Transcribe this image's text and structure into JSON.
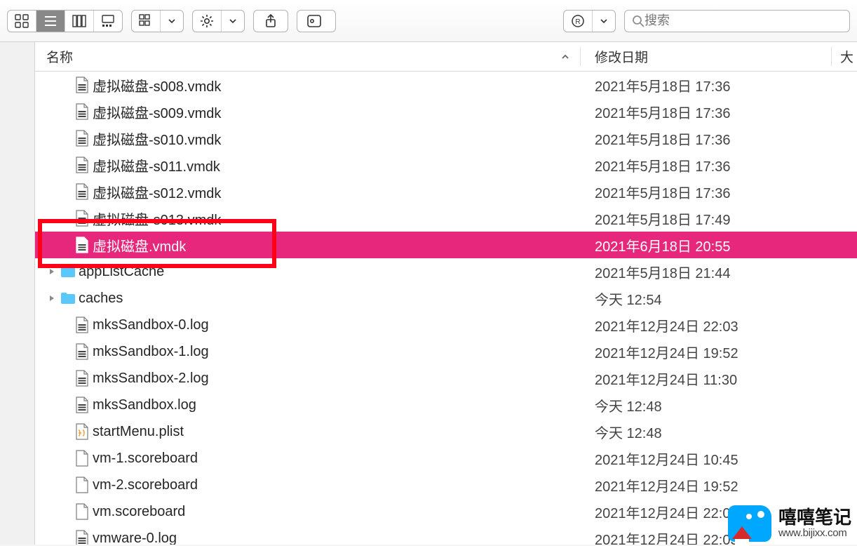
{
  "toolbar": {
    "search_placeholder": "搜索"
  },
  "columns": {
    "name": "名称",
    "date": "修改日期",
    "size": "大"
  },
  "files": [
    {
      "name": "虚拟磁盘-s008.vmdk",
      "date": "2021年5月18日 17:36",
      "type": "vmdk",
      "indent": 1
    },
    {
      "name": "虚拟磁盘-s009.vmdk",
      "date": "2021年5月18日 17:36",
      "type": "vmdk",
      "indent": 1
    },
    {
      "name": "虚拟磁盘-s010.vmdk",
      "date": "2021年5月18日 17:36",
      "type": "vmdk",
      "indent": 1
    },
    {
      "name": "虚拟磁盘-s011.vmdk",
      "date": "2021年5月18日 17:36",
      "type": "vmdk",
      "indent": 1
    },
    {
      "name": "虚拟磁盘-s012.vmdk",
      "date": "2021年5月18日 17:36",
      "type": "vmdk",
      "indent": 1
    },
    {
      "name": "虚拟磁盘-s013.vmdk",
      "date": "2021年5月18日 17:49",
      "type": "vmdk",
      "indent": 1
    },
    {
      "name": "虚拟磁盘.vmdk",
      "date": "2021年6月18日 20:55",
      "type": "vmdk",
      "indent": 1,
      "selected": true
    },
    {
      "name": "appListCache",
      "date": "2021年5月18日 21:44",
      "type": "folder",
      "indent": 0,
      "expandable": true
    },
    {
      "name": "caches",
      "date": "今天 12:54",
      "type": "folder",
      "indent": 0,
      "expandable": true
    },
    {
      "name": "mksSandbox-0.log",
      "date": "2021年12月24日 22:03",
      "type": "log",
      "indent": 1
    },
    {
      "name": "mksSandbox-1.log",
      "date": "2021年12月24日 19:52",
      "type": "log",
      "indent": 1
    },
    {
      "name": "mksSandbox-2.log",
      "date": "2021年12月24日 11:30",
      "type": "log",
      "indent": 1
    },
    {
      "name": "mksSandbox.log",
      "date": "今天 12:48",
      "type": "log",
      "indent": 1
    },
    {
      "name": "startMenu.plist",
      "date": "今天 12:48",
      "type": "plist",
      "indent": 1
    },
    {
      "name": "vm-1.scoreboard",
      "date": "2021年12月24日 10:45",
      "type": "blank",
      "indent": 1
    },
    {
      "name": "vm-2.scoreboard",
      "date": "2021年12月24日 19:52",
      "type": "blank",
      "indent": 1
    },
    {
      "name": "vm.scoreboard",
      "date": "2021年12月24日 22:03",
      "type": "blank",
      "indent": 1
    },
    {
      "name": "vmware-0.log",
      "date": "2021年12月24日 22:03",
      "type": "log",
      "indent": 1
    }
  ],
  "watermark": {
    "title": "嘻嘻笔记",
    "url": "www.bijixx.com"
  }
}
